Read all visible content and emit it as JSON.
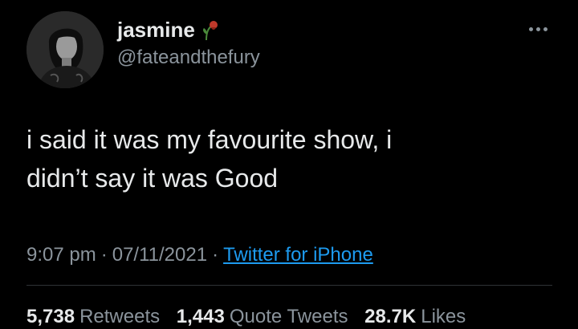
{
  "author": {
    "name": "jasmine",
    "handle": "@fateandthefury"
  },
  "icons": {
    "more": "more-dots-icon",
    "name_emoji": "wilted-flower-icon",
    "avatar": "avatar"
  },
  "tweet": {
    "text": "i said it was my favourite show, i\ndidn’t say it was Good"
  },
  "meta": {
    "time": "9:07 pm",
    "separator": "·",
    "date": "07/11/2021",
    "source": "Twitter for iPhone"
  },
  "stats": {
    "retweets_count": "5,738",
    "retweets_label": "Retweets",
    "quotes_count": "1,443",
    "quotes_label": "Quote Tweets",
    "likes_count": "28.7K",
    "likes_label": "Likes"
  },
  "colors": {
    "background": "#000000",
    "text": "#e7e9ea",
    "secondary": "#8b949c",
    "link": "#1d9bf0",
    "divider": "#2f3336"
  }
}
